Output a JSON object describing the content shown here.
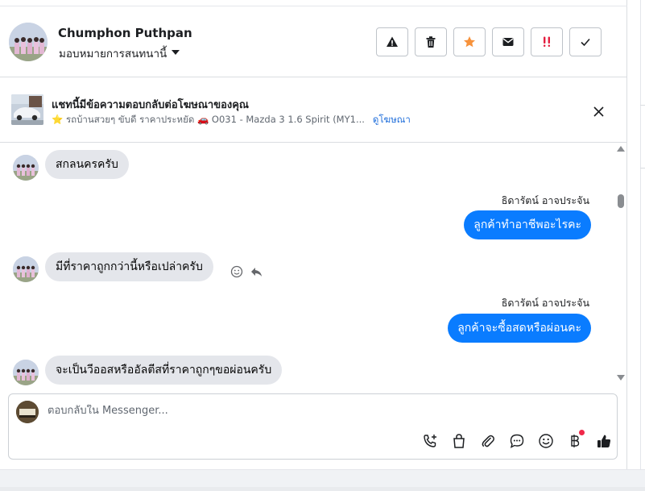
{
  "header": {
    "contact_name": "Chumphon Puthpan",
    "assign_label": "มอบหมายการสนทนานี้",
    "actions": [
      {
        "name": "report",
        "icon": "warning-icon"
      },
      {
        "name": "delete",
        "icon": "trash-icon"
      },
      {
        "name": "star",
        "icon": "star-icon",
        "color": "#f7923b"
      },
      {
        "name": "mark-unread",
        "icon": "envelope-icon"
      },
      {
        "name": "spam",
        "icon": "exclamation-icon",
        "color": "#e41e3f"
      },
      {
        "name": "done",
        "icon": "checkmark-icon"
      }
    ]
  },
  "ad": {
    "title": "แชทนี้มีข้อความตอบกลับต่อโฆษณาของคุณ",
    "subtitle": "⭐ รถบ้านสวยๆ ขับดี ราคาประหยัด 🚗 O031 - Mazda 3 1.6 Spirit (MY1...",
    "link": "ดูโฆษณา"
  },
  "messages": [
    {
      "dir": "in",
      "text": "สกลนครครับ"
    },
    {
      "dir": "out",
      "sender": "ธิดารัตน์ อาจประจัน",
      "text": "ลูกค้าทำอาชีพอะไรคะ"
    },
    {
      "dir": "in",
      "text": "มีที่ราคาถูกกว่านี้หรือเปล่าครับ"
    },
    {
      "dir": "out",
      "sender": "ธิดารัตน์ อาจประจัน",
      "text": "ลูกค้าจะซื้อสดหรือผ่อนคะ"
    },
    {
      "dir": "in",
      "text": "จะเป็นวีออสหรืออัลตีสที่ราคาถูกๆขอผ่อนครับ"
    }
  ],
  "composer": {
    "placeholder": "ตอบกลับใน Messenger...",
    "tools": [
      "phone-add-icon",
      "shopping-bag-icon",
      "paperclip-icon",
      "chat-bubble-icon",
      "emoji-icon",
      "baht-icon",
      "thumbs-up-icon"
    ]
  },
  "colors": {
    "outgoing_bubble": "#0a7cff",
    "incoming_bubble": "#e4e6eb",
    "link": "#216fdb",
    "star": "#f7923b",
    "spam": "#e41e3f"
  }
}
